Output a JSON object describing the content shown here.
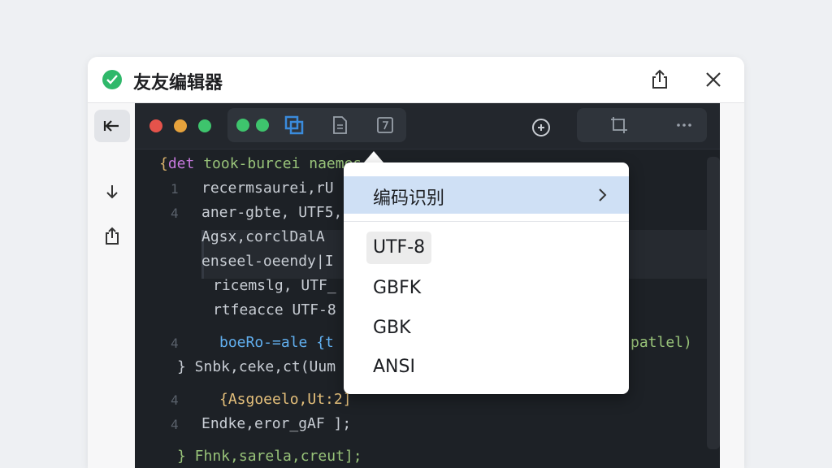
{
  "window": {
    "title": "友友编辑器"
  },
  "titlebar": {
    "status_icon": "check-circle-icon",
    "actions": [
      "share-icon",
      "close-icon"
    ]
  },
  "sidebar": {
    "items": [
      {
        "icon": "back-arrow-icon",
        "active": true
      },
      {
        "icon": "download-icon",
        "active": false
      },
      {
        "icon": "export-icon",
        "active": false
      }
    ]
  },
  "editor": {
    "window_dots": [
      "#e5534b",
      "#e6a23c",
      "#3ec46d"
    ],
    "toolbar_left": [
      "green-dots-icon",
      "layers-icon",
      "document-icon",
      "file-code-icon"
    ],
    "toolbar_right": [
      "refresh-icon",
      "crop-icon",
      "more-icon"
    ],
    "code_lines": [
      "{det took-burcei naemes:{",
      "recermsaurei,rU",
      "aner-gbte, UTF5,",
      "Agsx,corclDalA",
      "enseel-oeendy|I",
      "ricemslg, UTF_",
      "rtfeacce UTF-8",
      "boeRo-=ale {t",
      "} Snbk,ceke,ct(Uum",
      "{Asgoeelo,Ut:2]",
      "Endke,eror_gAF ];",
      "} Fhnk,sarela,creut];"
    ],
    "right_fragment": "patlel)",
    "gutter_marks": [
      "1",
      "4",
      "4",
      "4",
      "4"
    ]
  },
  "dropdown": {
    "header": "编码识别",
    "items": [
      "UTF-8",
      "GBFK",
      "GBK",
      "ANSI"
    ],
    "selected": "UTF-8"
  },
  "colors": {
    "accent": "#cfe0f5",
    "status": "#2fb86a",
    "editor_bg": "#1d2126"
  }
}
